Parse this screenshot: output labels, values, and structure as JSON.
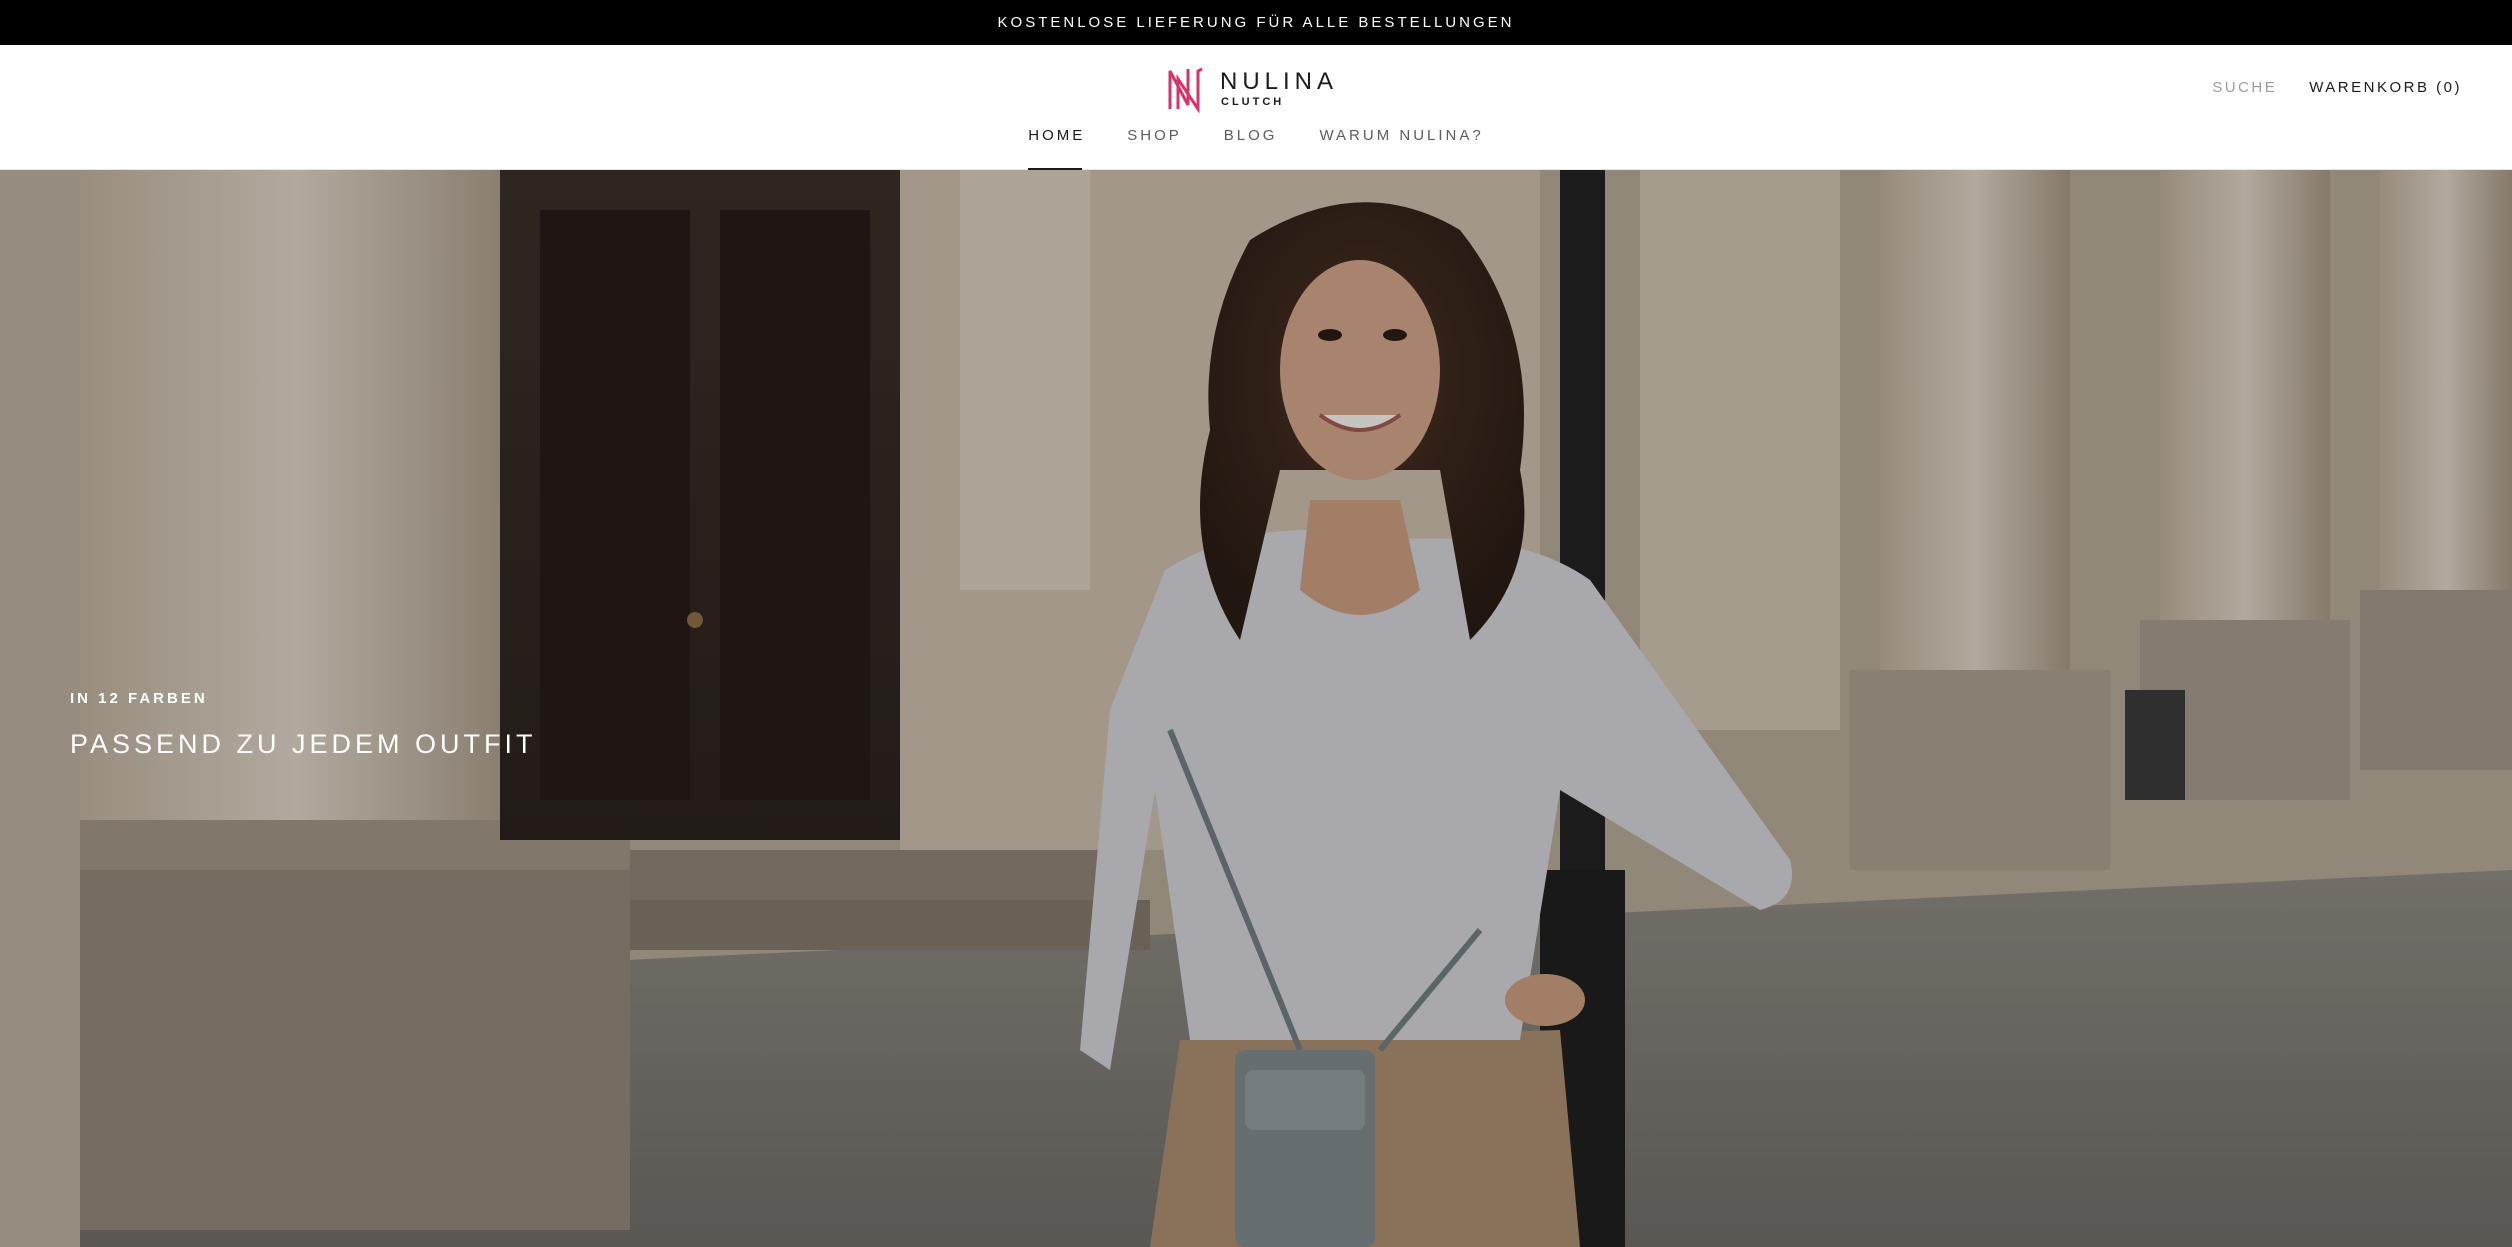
{
  "announcement": {
    "text": "KOSTENLOSE LIEFERUNG FÜR ALLE BESTELLUNGEN"
  },
  "logo": {
    "name": "NULINA",
    "sub": "CLUTCH",
    "brand_color": "#d6336c"
  },
  "header": {
    "search_label": "SUCHE",
    "cart_label": "WARENKORB (0)"
  },
  "nav": {
    "items": [
      {
        "label": "HOME",
        "active": true
      },
      {
        "label": "SHOP"
      },
      {
        "label": "BLOG"
      },
      {
        "label": "WARUM NULINA?"
      }
    ]
  },
  "hero": {
    "subheading": "IN 12 FARBEN",
    "heading": "PASSEND ZU JEDEM OUTFIT"
  },
  "colors": {
    "announcement_bg": "#000000",
    "text": "#1c1b1b",
    "muted": "#9c9c9c"
  }
}
